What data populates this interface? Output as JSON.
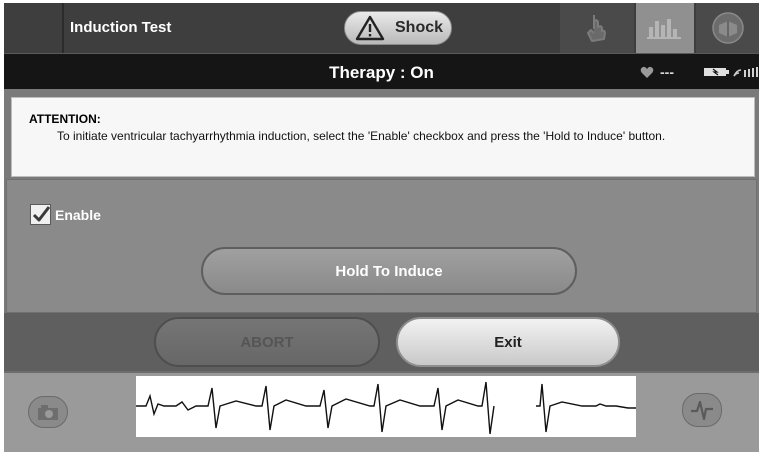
{
  "titlebar": {
    "title": "Induction Test",
    "shock_label": "Shock",
    "icons": [
      "warning-triangle-icon",
      "hand-pointer-icon",
      "bar-graph-icon",
      "book-icon"
    ]
  },
  "status": {
    "therapy": "Therapy : On",
    "heart_rate": "---",
    "icons": [
      "heart-icon",
      "battery-icon",
      "telemetry-signal-icon"
    ]
  },
  "attention": {
    "heading": "ATTENTION:",
    "message": "To initiate ventricular tachyarrhythmia induction, select the 'Enable' checkbox and press the 'Hold to Induce' button."
  },
  "controls": {
    "enable_label": "Enable",
    "enable_checked": true,
    "hold_label": "Hold To Induce",
    "abort_label": "ABORT",
    "exit_label": "Exit"
  },
  "egm": {
    "icons": [
      "camera-icon",
      "egm-waveform-icon"
    ]
  },
  "colors": {
    "titlebar": "#3e3e3e",
    "statusbar": "#151515",
    "panel": "#8a8a8a",
    "attention_bg": "#f7f7f7"
  }
}
